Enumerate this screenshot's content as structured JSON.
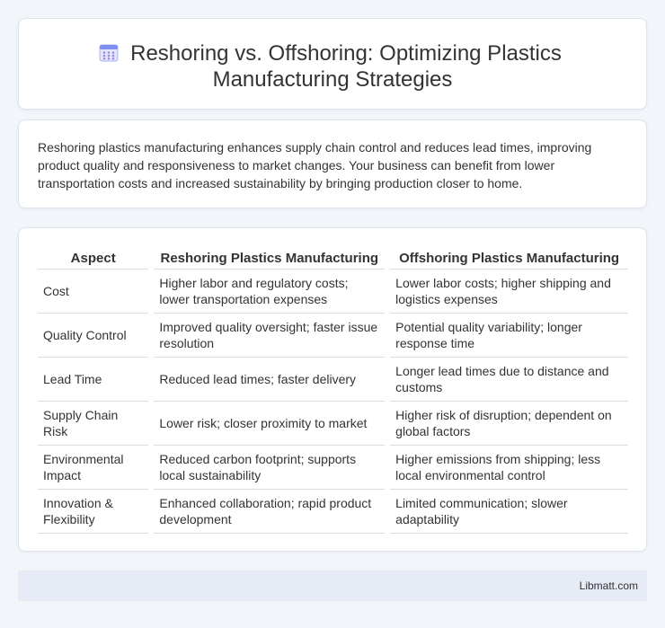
{
  "header": {
    "title_line1": "Reshoring vs. Offshoring: Optimizing Plastics",
    "title_line2": "Manufacturing Strategies",
    "icon": "calendar-icon"
  },
  "intro": {
    "text": "Reshoring plastics manufacturing enhances supply chain control and reduces lead times, improving product quality and responsiveness to market changes. Your business can benefit from lower transportation costs and increased sustainability by bringing production closer to home."
  },
  "table": {
    "headers": [
      "Aspect",
      "Reshoring Plastics Manufacturing",
      "Offshoring Plastics Manufacturing"
    ],
    "rows": [
      [
        "Cost",
        "Higher labor and regulatory costs; lower transportation expenses",
        "Lower labor costs; higher shipping and logistics expenses"
      ],
      [
        "Quality Control",
        "Improved quality oversight; faster issue resolution",
        "Potential quality variability; longer response time"
      ],
      [
        "Lead Time",
        "Reduced lead times; faster delivery",
        "Longer lead times due to distance and customs"
      ],
      [
        "Supply Chain Risk",
        "Lower risk; closer proximity to market",
        "Higher risk of disruption; dependent on global factors"
      ],
      [
        "Environmental Impact",
        "Reduced carbon footprint; supports local sustainability",
        "Higher emissions from shipping; less local environmental control"
      ],
      [
        "Innovation & Flexibility",
        "Enhanced collaboration; rapid product development",
        "Limited communication; slower adaptability"
      ]
    ]
  },
  "footer": {
    "text": "Libmatt.com"
  },
  "colors": {
    "background": "#f2f5fa",
    "card": "#ffffff",
    "footer": "#e6ebf5",
    "icon_accent": "#8a7be8"
  }
}
